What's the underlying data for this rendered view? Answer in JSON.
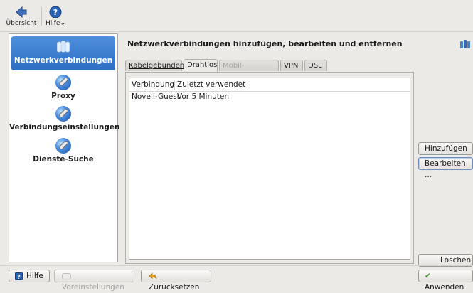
{
  "toolbar": {
    "overview_label": "Übersicht",
    "help_label": "Hilfe",
    "help_arrow": "⌄"
  },
  "sidebar": {
    "items": [
      {
        "label": "Netzwerkverbindungen",
        "icon": "network-connections-icon"
      },
      {
        "label": "Proxy",
        "icon": "wrench-globe-icon"
      },
      {
        "label": "Verbindungseinstellungen",
        "icon": "wrench-globe-icon"
      },
      {
        "label": "Dienste-Suche",
        "icon": "wrench-globe-icon"
      }
    ]
  },
  "main": {
    "heading": "Netzwerkverbindungen hinzufügen, bearbeiten und entfernen",
    "tabs": [
      {
        "label": "Kabelgebunden",
        "state": "normal"
      },
      {
        "label": "Drahtlos",
        "state": "active"
      },
      {
        "label": "Mobil-Breitband",
        "state": "disabled"
      },
      {
        "label": "VPN",
        "state": "normal"
      },
      {
        "label": "DSL",
        "state": "normal"
      }
    ],
    "table": {
      "columns": [
        "Verbindung",
        "Zuletzt verwendet"
      ],
      "rows": [
        [
          "Novell-Guest",
          "Vor 5 Minuten"
        ]
      ]
    }
  },
  "side_buttons": {
    "add": "Hinzufügen ...",
    "edit": "Bearbeiten ...",
    "delete": "Löschen"
  },
  "footer": {
    "help": "Hilfe",
    "defaults": "Voreinstellungen",
    "reset": "Zurücksetzen",
    "apply": "Anwenden"
  },
  "colors": {
    "accent": "#2d6ec3",
    "window_bg": "#eceae7"
  }
}
